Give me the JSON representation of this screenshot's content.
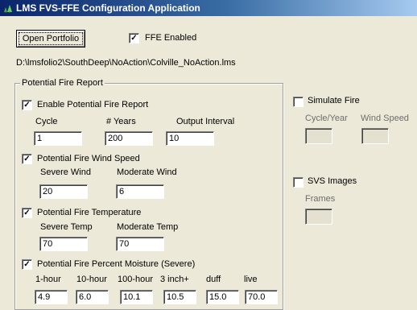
{
  "window": {
    "title": "LMS FVS-FFE Configuration Application",
    "accent": "#0a246a"
  },
  "toolbar": {
    "open_portfolio_label": "Open Portfolio",
    "ffe_enabled_label": "FFE Enabled",
    "ffe_enabled_checked": true
  },
  "file_path": "D:\\lmsfolio2\\SouthDeep\\NoAction\\Colville_NoAction.lms",
  "fire_report": {
    "group_title": "Potential Fire Report",
    "enable": {
      "label": "Enable Potential Fire Report",
      "checked": true,
      "cycle_label": "Cycle",
      "years_label": "# Years",
      "interval_label": "Output Interval",
      "cycle_value": "1",
      "years_value": "200",
      "interval_value": "10"
    },
    "wind": {
      "label": "Potential Fire Wind Speed",
      "checked": true,
      "severe_label": "Severe Wind",
      "moderate_label": "Moderate Wind",
      "severe_value": "20",
      "moderate_value": "6"
    },
    "temperature": {
      "label": "Potential Fire Temperature",
      "checked": true,
      "severe_label": "Severe Temp",
      "moderate_label": "Moderate Temp",
      "severe_value": "70",
      "moderate_value": "70"
    },
    "moisture": {
      "label": "Potential Fire Percent Moisture (Severe)",
      "checked": true,
      "col_labels": [
        "1-hour",
        "10-hour",
        "100-hour",
        "3 inch+",
        "duff",
        "live"
      ],
      "values": [
        "4.9",
        "6.0",
        "10.1",
        "10.5",
        "15.0",
        "70.0"
      ]
    }
  },
  "simulate_fire": {
    "label": "Simulate Fire",
    "checked": false,
    "cycle_year_label": "Cycle/Year",
    "wind_speed_label": "Wind Speed",
    "cycle_year_value": "",
    "wind_speed_value": ""
  },
  "svs_images": {
    "label": "SVS Images",
    "checked": false,
    "frames_label": "Frames",
    "frames_value": ""
  }
}
